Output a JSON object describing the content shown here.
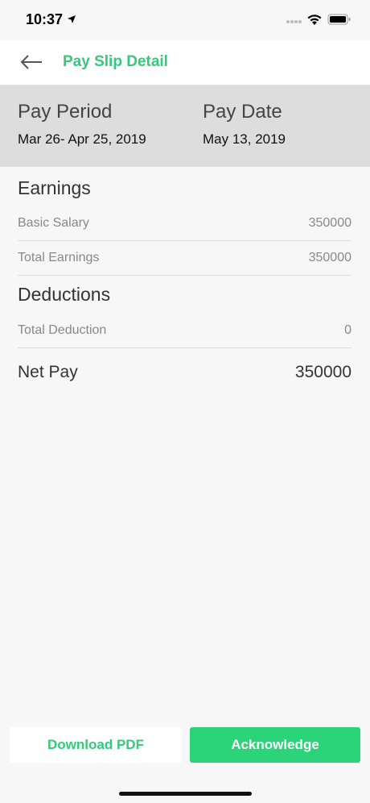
{
  "status_bar": {
    "time": "10:37"
  },
  "nav": {
    "title": "Pay Slip Detail"
  },
  "pay_header": {
    "period_label": "Pay Period",
    "period_value": "Mar 26- Apr 25, 2019",
    "date_label": "Pay Date",
    "date_value": "May 13, 2019"
  },
  "earnings": {
    "title": "Earnings",
    "rows": [
      {
        "label": "Basic Salary",
        "value": "350000"
      },
      {
        "label": "Total Earnings",
        "value": "350000"
      }
    ]
  },
  "deductions": {
    "title": "Deductions",
    "rows": [
      {
        "label": "Total Deduction",
        "value": "0"
      }
    ]
  },
  "net_pay": {
    "label": "Net Pay",
    "value": "350000"
  },
  "footer": {
    "download_label": "Download PDF",
    "acknowledge_label": "Acknowledge"
  },
  "colors": {
    "accent": "#35c97a",
    "button_green": "#2bd479",
    "header_gray": "#dddddd"
  },
  "icons": [
    "location-arrow-icon",
    "signal-icon",
    "wifi-icon",
    "battery-icon",
    "back-arrow-icon"
  ]
}
